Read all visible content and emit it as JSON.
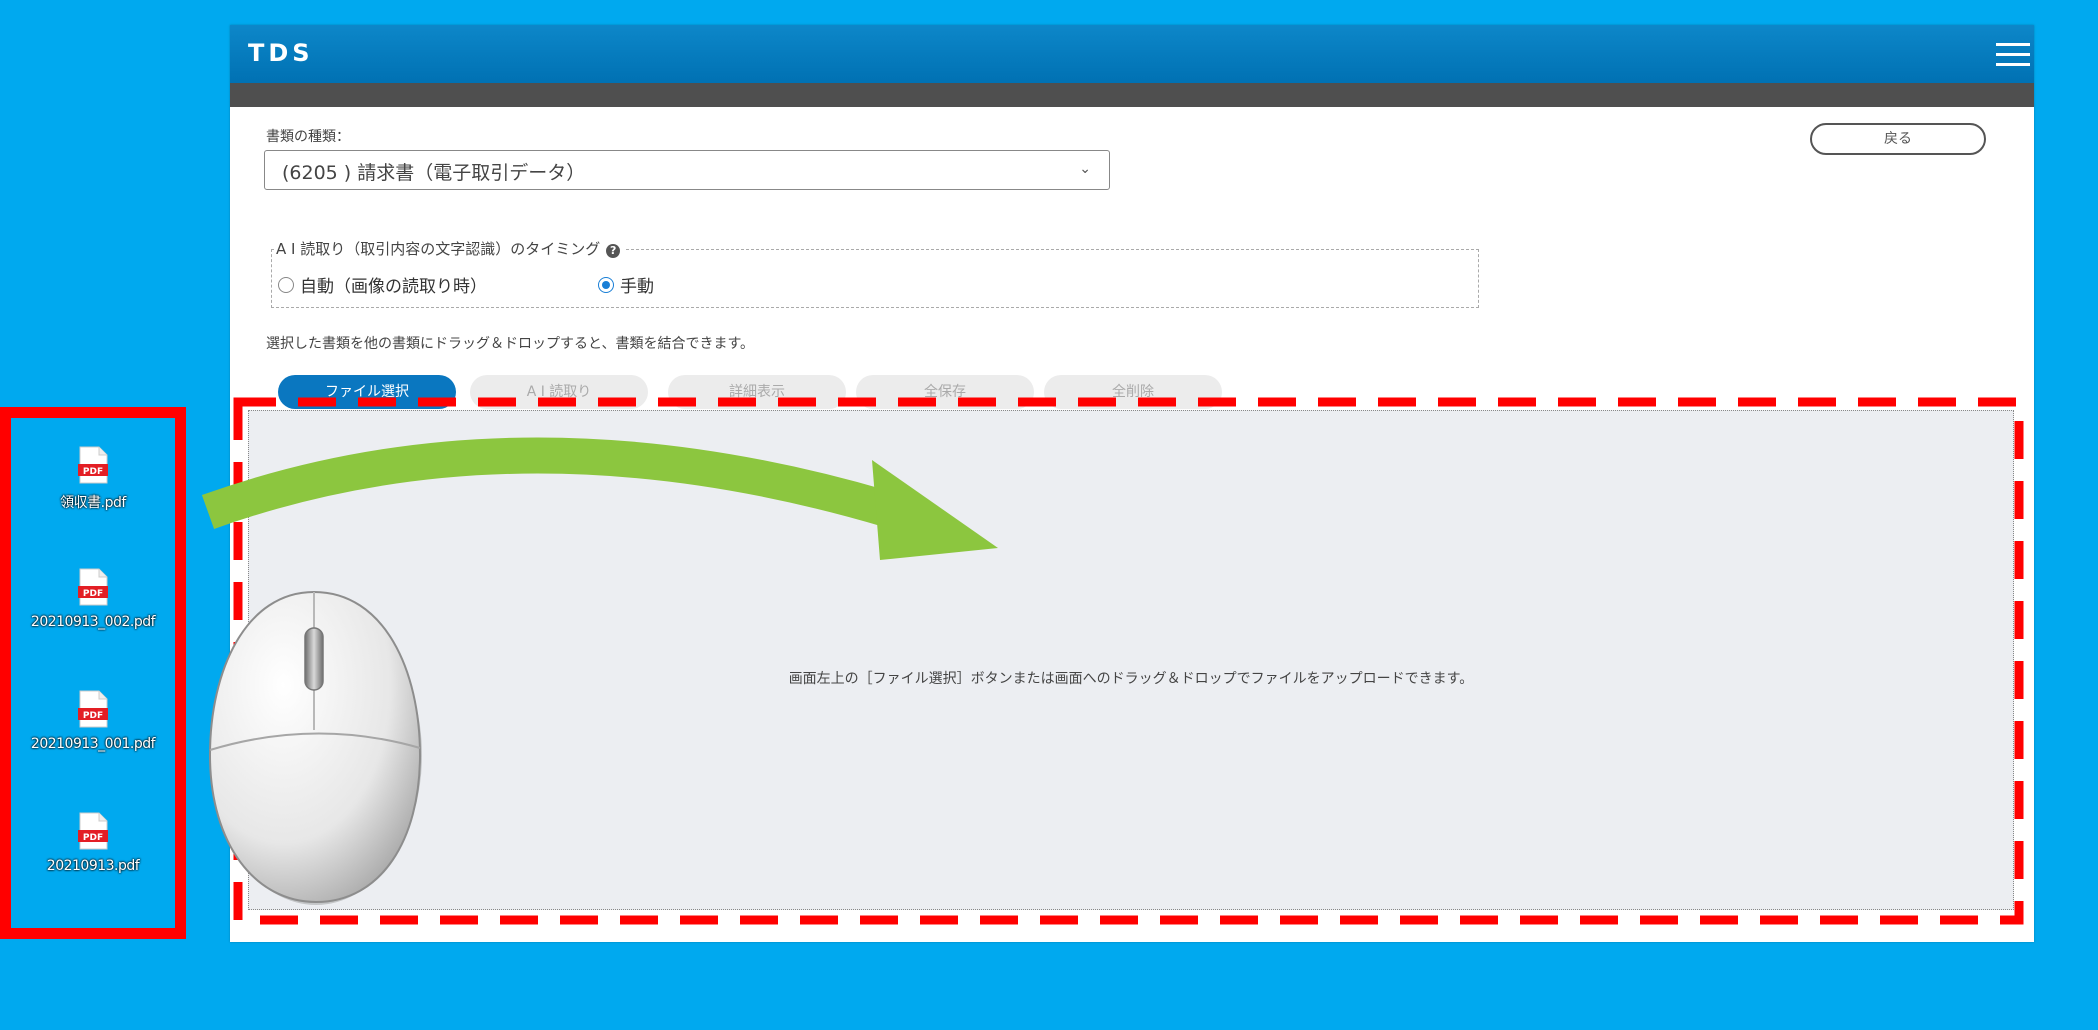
{
  "app": {
    "title": "TDS",
    "doc_type_label": "書類の種類：",
    "doc_type_value": "(6205 ) 請求書（電子取引データ）",
    "back_button": "戻る",
    "ai_timing": {
      "legend": "A I 読取り（取引内容の文字認識）のタイミング",
      "options": [
        {
          "label": "自動（画像の読取り時）",
          "checked": false
        },
        {
          "label": "手動",
          "checked": true
        }
      ]
    },
    "instruction": "選択した書類を他の書類にドラッグ＆ドロップすると、書類を結合できます。",
    "buttons": {
      "file_select": "ファイル選択",
      "ai_read": "A I 読取り",
      "detail": "詳細表示",
      "save_all": "全保存",
      "delete_all": "全削除"
    },
    "drop_message": "画面左上の［ファイル選択］ボタンまたは画面へのドラッグ＆ドロップでファイルをアップロードできます。"
  },
  "desktop_files": [
    {
      "name": "領収書.pdf",
      "icon": "pdf-file-icon"
    },
    {
      "name": "20210913_002.pdf",
      "icon": "pdf-file-icon"
    },
    {
      "name": "20210913_001.pdf",
      "icon": "pdf-file-icon"
    },
    {
      "name": "20210913.pdf",
      "icon": "pdf-file-icon"
    }
  ],
  "pdf_badge": "PDF",
  "colors": {
    "background": "#00a9ef",
    "titlebar": "#0071b3",
    "highlight": "#ff0000",
    "arrow": "#8cc63f",
    "primary_button": "#0a77c0"
  },
  "icons": [
    "hamburger-menu-icon",
    "help-icon",
    "chevron-down-icon",
    "pdf-file-icon",
    "mouse-icon",
    "arrow-icon"
  ]
}
